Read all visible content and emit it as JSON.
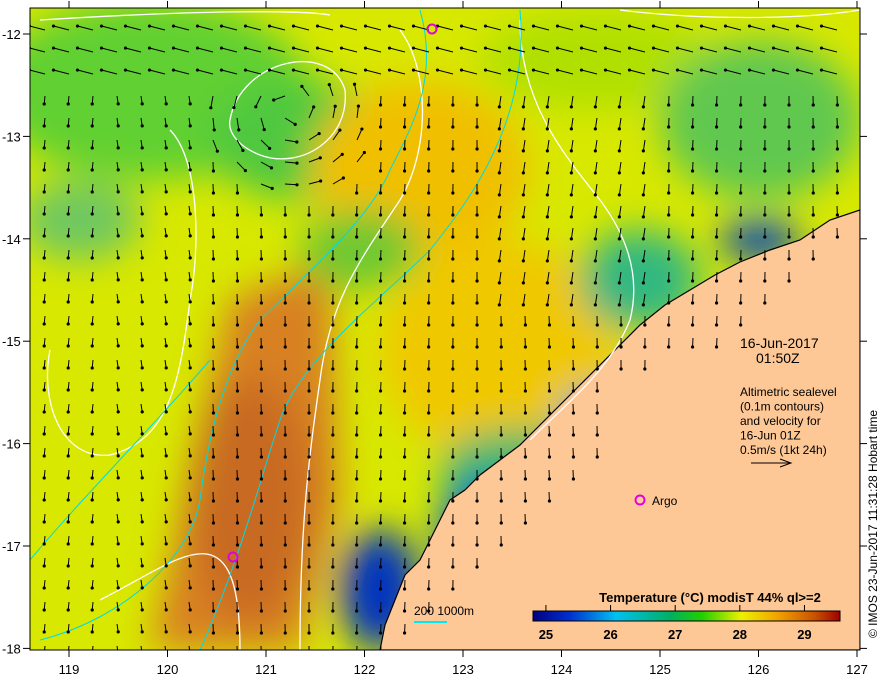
{
  "map": {
    "x_ticks": [
      "119",
      "120",
      "121",
      "122",
      "123",
      "124",
      "125",
      "126",
      "127"
    ],
    "y_ticks": [
      "-12",
      "-13",
      "-14",
      "-15",
      "-16",
      "-17",
      "-18"
    ],
    "date": "16-Jun-2017",
    "time": "01:50Z",
    "caption_lines": [
      "Altimetric sealevel",
      "(0.1m contours)",
      "and velocity for",
      "16-Jun 01Z",
      "0.5m/s (1kt 24h)"
    ],
    "argo_label": "Argo",
    "isobath_label": "200  1000m",
    "credit": "© IMOS 23-Jun-2017 11:31:28 Hobart time",
    "colorbar": {
      "title": "Temperature (°C) modisT 44% ql>=2",
      "ticks": [
        "25",
        "26",
        "27",
        "28",
        "29"
      ],
      "range": [
        24.8,
        29.55
      ]
    },
    "colors": {
      "land": "#fdc896",
      "contour": "#ffffff",
      "isobath": "#00e0e0",
      "argo": "#e000e0",
      "vector": "#000000"
    }
  }
}
